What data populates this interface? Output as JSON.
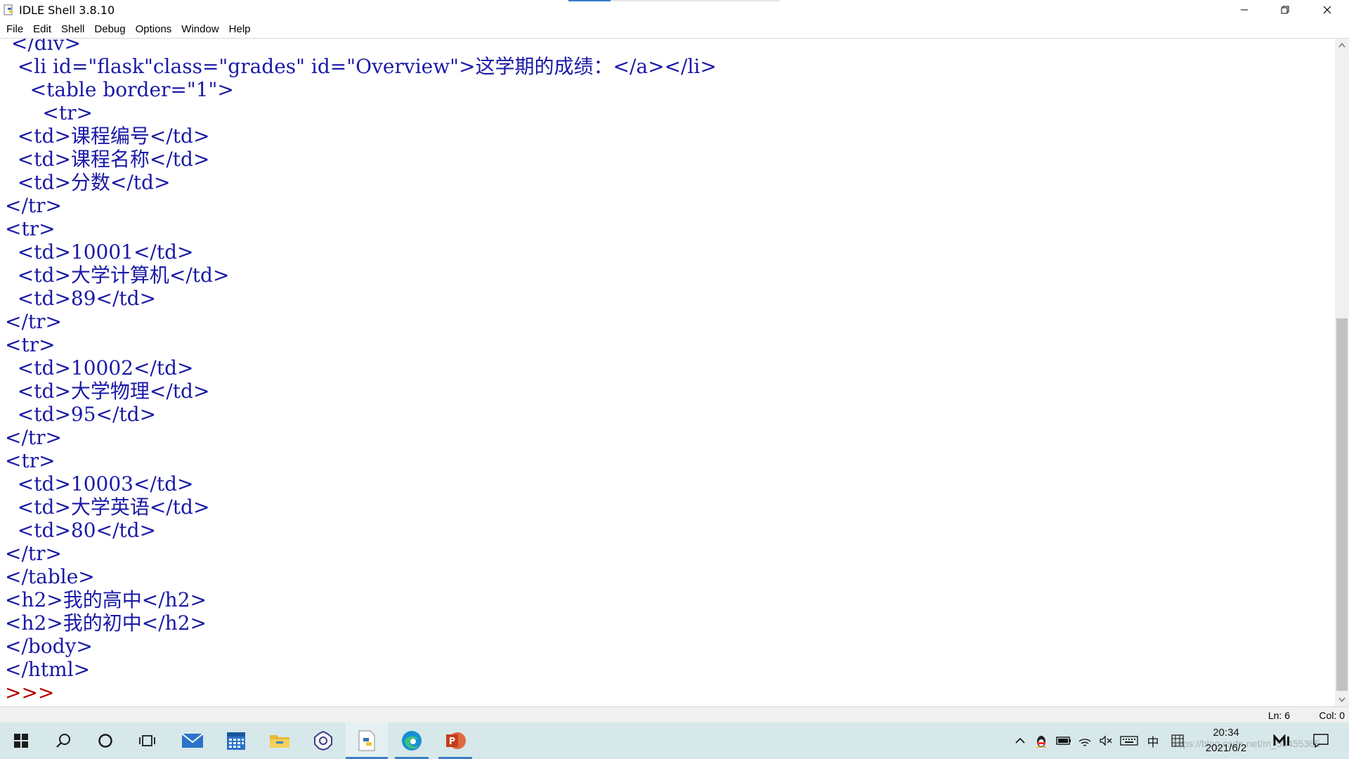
{
  "window": {
    "title": "IDLE Shell 3.8.10"
  },
  "menu": {
    "items": [
      "File",
      "Edit",
      "Shell",
      "Debug",
      "Options",
      "Window",
      "Help"
    ]
  },
  "editor": {
    "lines": [
      " </div>",
      "  <li id=\"flask\"class=\"grades\" id=\"Overview\">这学期的成绩：</a></li>",
      "    <table border=\"1\">",
      "      <tr>",
      "  <td>课程编号</td>",
      "  <td>课程名称</td>",
      "  <td>分数</td>",
      "</tr>",
      "<tr>",
      "  <td>10001</td>",
      "  <td>大学计算机</td>",
      "  <td>89</td>",
      "</tr>",
      "<tr>",
      "  <td>10002</td>",
      "  <td>大学物理</td>",
      "  <td>95</td>",
      "</tr>",
      "<tr>",
      "  <td>10003</td>",
      "  <td>大学英语</td>",
      "  <td>80</td>",
      "</tr>",
      "</table>",
      "<h2>我的高中</h2>",
      "<h2>我的初中</h2>",
      "</body>",
      "</html>"
    ],
    "prompt": ">>>"
  },
  "status": {
    "ln": "Ln: 6",
    "col": "Col: 0"
  },
  "taskbar": {
    "time": "20:34",
    "date": "2021/6/2",
    "ime_label": "中",
    "watermark": "https://blog.csdn.net/m_53455365"
  },
  "colors": {
    "code_text": "#1a1aa6",
    "prompt": "#b00000",
    "taskbar_bg": "#d7e8ea"
  }
}
